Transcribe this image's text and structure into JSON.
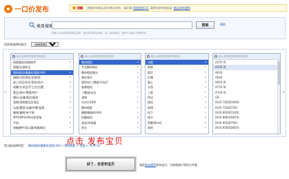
{
  "header": {
    "logo_icon": "coin-icon",
    "logo_text": "一口价发布",
    "notice_title": "提醒：",
    "notice_body": "违规发布商品30分钟后发布，请开通",
    "notice_link_1": "阿里旺旺1天",
    "notice_body_2": "请您在发布前阅读",
    "notice_link_2": "商品发布规则"
  },
  "search": {
    "label": "类目搜索：",
    "placeholder": "",
    "button": "搜索",
    "help": "帮助",
    "tip": "请输入商品品牌或属性名称，按回车到类目搜索。如：数码相机、数码产品输入品牌型号。"
  },
  "recent": {
    "label": "您经常选择的类目：",
    "selected": "[请选择类目]"
  },
  "category_columns": [
    {
      "search_placeholder": "输入名称或拼音首字母查找",
      "items": [
        {
          "label": "网络服务/网络软件",
          "arrow": true
        },
        {
          "label": "保健品/滋补品",
          "arrow": true
        },
        {
          "label": "数码相机/摄像机/图形冲印",
          "arrow": true,
          "selected": true
        },
        {
          "label": "服装日用/家纺/女装/家",
          "arrow": true
        },
        {
          "label": "床上用品/布艺/家纺/毛巾",
          "arrow": true
        },
        {
          "label": "收藏/艺术品/手工艺/古董",
          "arrow": true
        },
        {
          "label": "食品/茶叶/零食/特产",
          "arrow": true
        },
        {
          "label": "模玩/动漫/周边/桌游",
          "arrow": true
        },
        {
          "label": "宠物/宠物食品及用品",
          "arrow": true
        },
        {
          "label": "玩具/模型/动漫/早教/益智",
          "arrow": true
        },
        {
          "label": "童装/童鞋/亲子装",
          "arrow": true
        },
        {
          "label": "MP3/MP4/iPod/录音笔",
          "arrow": true
        },
        {
          "label": "手机",
          "arrow": true
        },
        {
          "label": "电脑硬件/显示器/电脑周边",
          "arrow": true
        }
      ]
    },
    {
      "search_placeholder": "输入名称或拼音首字母查找",
      "items": [
        {
          "label": "数码相机",
          "arrow": true,
          "selected": true
        },
        {
          "label": "专业数码单反",
          "arrow": true
        },
        {
          "label": "数码相机镜头",
          "arrow": true
        },
        {
          "label": "单反镜头",
          "arrow": true
        },
        {
          "label": "相机包/三脚架/闪光灯",
          "arrow": true
        },
        {
          "label": "胶卷相机",
          "arrow": true
        },
        {
          "label": "三脚架/云台",
          "arrow": true
        },
        {
          "label": "滤镜",
          "arrow": true
        },
        {
          "label": "闪光灯/附件",
          "arrow": true
        },
        {
          "label": "数码相框",
          "arrow": true
        },
        {
          "label": "摄影棚器材/冲印",
          "arrow": true
        },
        {
          "label": "拍摄相机",
          "arrow": true
        },
        {
          "label": "电池/充电器",
          "arrow": true
        },
        {
          "label": "其它",
          "arrow": true
        }
      ]
    },
    {
      "search_placeholder": "输入名称或拼音首字母查找",
      "items": [
        {
          "label": "佳能",
          "arrow": true,
          "selected": true
        },
        {
          "label": "奥林",
          "arrow": true
        },
        {
          "label": "索尼",
          "arrow": true
        },
        {
          "label": "尼康",
          "arrow": true
        },
        {
          "label": "富士",
          "arrow": true
        },
        {
          "label": "卡西",
          "arrow": true
        },
        {
          "label": "三星",
          "arrow": true
        },
        {
          "label": "柯达",
          "arrow": true
        },
        {
          "label": "理光",
          "arrow": true
        },
        {
          "label": "宾得",
          "arrow": true
        },
        {
          "label": "松下",
          "arrow": true
        },
        {
          "label": "徕卡",
          "arrow": true
        },
        {
          "label": "明基/BenQ",
          "arrow": true
        },
        {
          "label": "其他",
          "arrow": true
        }
      ]
    },
    {
      "search_placeholder": "输入名称或拼音首字母查找",
      "items": [
        {
          "label": "A570 IS",
          "arrow": false
        },
        {
          "label": "A590 IS",
          "arrow": false,
          "highlight": true
        },
        {
          "label": "A630",
          "arrow": false
        },
        {
          "label": "A640",
          "arrow": false
        },
        {
          "label": "A650 IS",
          "arrow": false
        },
        {
          "label": "A710 IS",
          "arrow": false
        },
        {
          "label": "A720 IS",
          "arrow": false
        },
        {
          "label": "G9",
          "arrow": false
        },
        {
          "label": "IXUS 70(SD1000)",
          "arrow": false
        },
        {
          "label": "IXUS 75(SD750)",
          "arrow": false
        },
        {
          "label": "IXUS 80(SD1100)",
          "arrow": false
        },
        {
          "label": "IXUS 860(SD870)",
          "arrow": false
        },
        {
          "label": "IXUS 90(SD790)",
          "arrow": false
        },
        {
          "label": "IXUS 950(SD850)",
          "arrow": false
        }
      ]
    }
  ],
  "selected_path": {
    "label": "您当前选择的是：",
    "path": "数码相机/摄像机/图形冲印 > 数码相机 > 佳能 > A590 IS"
  },
  "annotation": "点击 发布宝贝",
  "submit_button": "好了，去发布宝贝",
  "rules": {
    "prefix": "阅读",
    "link": "淘宝规则",
    "suffix": "发布宝贝，可有效减少您的工作量"
  },
  "colors": {
    "accent": "#f07a10",
    "selection": "#3366cc",
    "link": "#1a4fb0",
    "annotation": "#e01010"
  }
}
